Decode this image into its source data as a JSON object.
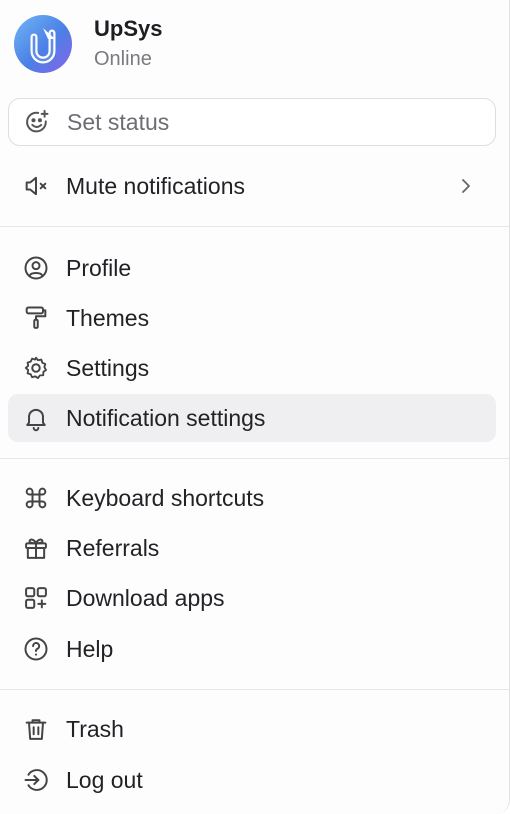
{
  "user": {
    "name": "UpSys",
    "status": "Online"
  },
  "set_status": {
    "label": "Set status"
  },
  "menu": {
    "mute": "Mute notifications",
    "profile": "Profile",
    "themes": "Themes",
    "settings": "Settings",
    "notification_settings": "Notification settings",
    "keyboard_shortcuts": "Keyboard shortcuts",
    "referrals": "Referrals",
    "download_apps": "Download apps",
    "help": "Help",
    "trash": "Trash",
    "log_out": "Log out"
  },
  "icons": {
    "avatar": "upsys-logo",
    "set_status": "smiley-plus-icon",
    "mute": "speaker-muted-icon",
    "mute_submenu": "chevron-right-icon",
    "profile": "user-circle-icon",
    "themes": "paint-roller-icon",
    "settings": "gear-icon",
    "notification_settings": "bell-icon",
    "keyboard_shortcuts": "command-key-icon",
    "referrals": "gift-icon",
    "download_apps": "apps-grid-plus-icon",
    "help": "question-circle-icon",
    "trash": "trash-icon",
    "log_out": "log-out-icon"
  },
  "active_item": "Notification settings",
  "colors": {
    "active_bg": "#efeff1",
    "text": "#222226",
    "muted_text": "#7a7a80",
    "divider": "#e7e7ea",
    "avatar_gradient_start": "#6fb6f5",
    "avatar_gradient_end": "#8a63e8"
  }
}
